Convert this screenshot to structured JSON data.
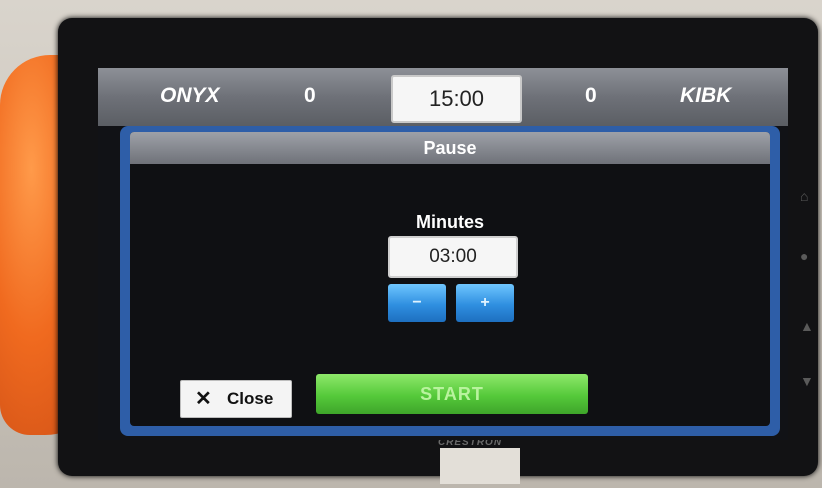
{
  "scoreboard": {
    "home_team": "ONYX",
    "home_score": "0",
    "clock": "15:00",
    "away_score": "0",
    "away_team": "KIBK"
  },
  "dialog": {
    "title": "Pause",
    "minutes_label": "Minutes",
    "minutes_value": "03:00",
    "decrement_label": "−",
    "increment_label": "+",
    "close_icon": "close-icon",
    "close_label": "Close",
    "start_label": "START"
  },
  "device": {
    "brand": "CRESTRON"
  },
  "colors": {
    "dialog_border": "#2e5ea8",
    "stepper_blue": "#2f8fe0",
    "start_green": "#55c93a"
  }
}
